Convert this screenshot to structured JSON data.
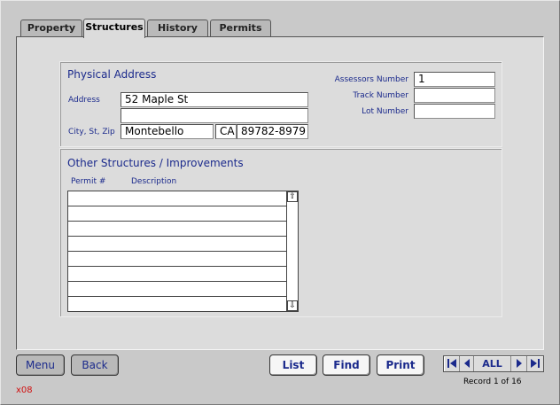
{
  "tabs": [
    {
      "label": "Property"
    },
    {
      "label": "Structures"
    },
    {
      "label": "History"
    },
    {
      "label": "Permits"
    }
  ],
  "physical_address": {
    "title": "Physical Address",
    "address_label": "Address",
    "address_line1": "52 Maple St",
    "address_line2": "",
    "city_label": "City, St, Zip",
    "city": "Montebello",
    "state": "CA",
    "zip": "89782-8979",
    "assessors_label": "Assessors Number",
    "assessors_value": "1",
    "track_label": "Track Number",
    "track_value": "",
    "lot_label": "Lot Number",
    "lot_value": ""
  },
  "structures": {
    "title": "Other Structures / Improvements",
    "col_permit": "Permit #",
    "col_description": "Description",
    "rows": [
      "",
      "",
      "",
      "",
      "",
      "",
      "",
      ""
    ]
  },
  "buttons": {
    "menu": "Menu",
    "back": "Back",
    "list": "List",
    "find": "Find",
    "print": "Print"
  },
  "navigator": {
    "all": "ALL",
    "record_status": "Record 1 of 16"
  },
  "footer_code": "x08"
}
